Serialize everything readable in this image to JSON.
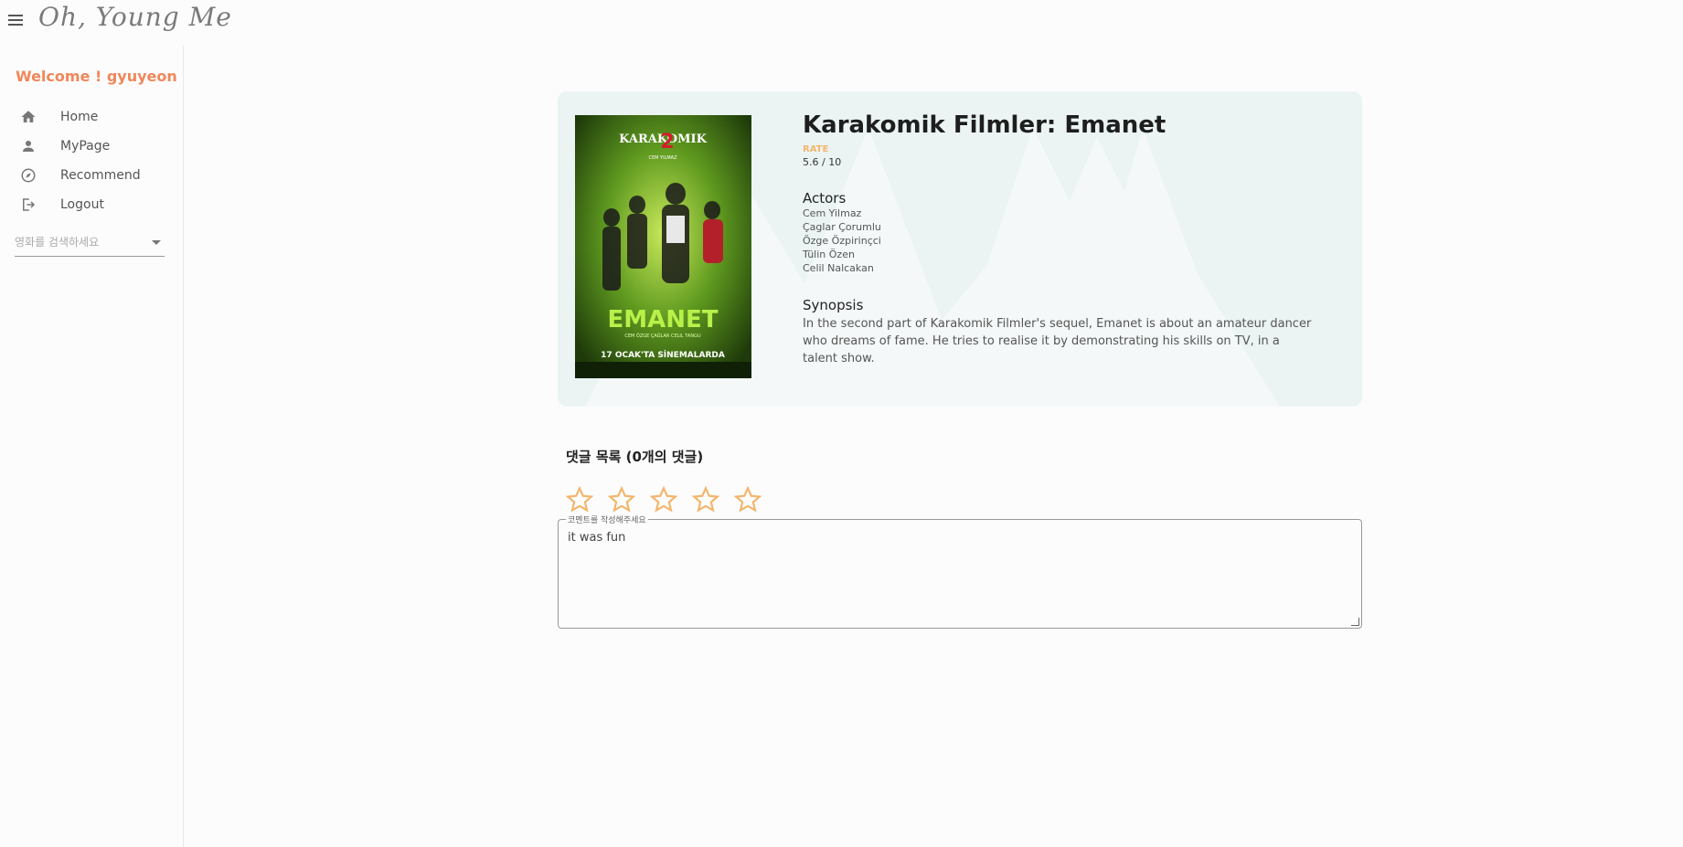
{
  "app": {
    "logo_text": "Oh, Young Me"
  },
  "sidebar": {
    "welcome": "Welcome ! gyuyeon",
    "items": [
      {
        "label": "Home",
        "icon": "home-icon"
      },
      {
        "label": "MyPage",
        "icon": "person-icon"
      },
      {
        "label": "Recommend",
        "icon": "compass-icon"
      },
      {
        "label": "Logout",
        "icon": "logout-icon"
      }
    ],
    "search": {
      "placeholder": "영화를 검색하세요",
      "value": ""
    }
  },
  "movie": {
    "title": "Karakomik Filmler: Emanet",
    "rate_label": "RATE",
    "rate_value": "5.6 / 10",
    "actors_heading": "Actors",
    "actors": [
      "Cem Yilmaz",
      "Çaglar Çorumlu",
      "Özge Özpirinçci",
      "Tülin Özen",
      "Celil Nalcakan"
    ],
    "synopsis_heading": "Synopsis",
    "synopsis": "In the second part of Karakomik Filmler's sequel, Emanet is about an amateur dancer who dreams of fame. He tries to realise it by demonstrating his skills on TV, in a talent show.",
    "poster": {
      "brand": "KARAKOMIK",
      "number": "2",
      "name": "EMANET",
      "director": "CEM YILMAZ",
      "cast_line": "CEM ÖZGE ÇAĞLAR CELIL TANGU",
      "release": "17 OCAK'TA SİNEMALARDA"
    }
  },
  "comments": {
    "heading": "댓글 목록 (0개의 댓글)",
    "rating": 0,
    "rating_max": 5,
    "field_label": "코멘트를 작성해주세요",
    "field_value": "it was fun"
  },
  "colors": {
    "accent": "#f0875a",
    "star": "#f3b56b",
    "card_bg": "#ebf4f3"
  }
}
